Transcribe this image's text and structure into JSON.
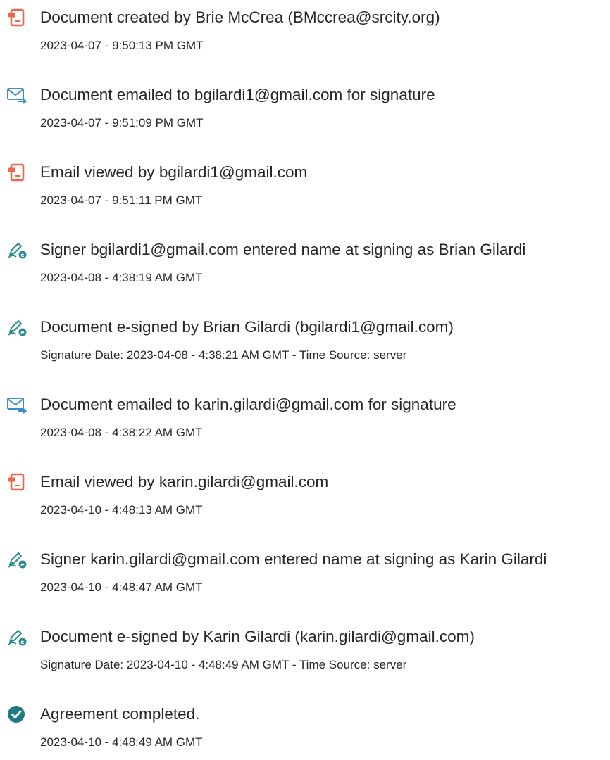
{
  "colors": {
    "doc_icon": "#e8684e",
    "email_icon": "#3d8fc9",
    "sign_icon": "#2b8a8f",
    "complete_icon": "#1f7a86",
    "text": "#262626"
  },
  "events": [
    {
      "icon": "document-icon",
      "title": "Document created by Brie McCrea (BMccrea@srcity.org)",
      "time": "2023-04-07 - 9:50:13 PM GMT"
    },
    {
      "icon": "email-send-icon",
      "title": "Document emailed to bgilardi1@gmail.com for signature",
      "time": "2023-04-07 - 9:51:09 PM GMT"
    },
    {
      "icon": "document-icon",
      "title": "Email viewed by bgilardi1@gmail.com",
      "time": "2023-04-07 - 9:51:11 PM GMT"
    },
    {
      "icon": "esign-pen-icon",
      "title": "Signer bgilardi1@gmail.com entered name at signing as Brian Gilardi",
      "time": "2023-04-08 - 4:38:19 AM GMT"
    },
    {
      "icon": "esign-pen-icon",
      "title": "Document e-signed by Brian Gilardi (bgilardi1@gmail.com)",
      "time": "Signature Date: 2023-04-08 - 4:38:21 AM GMT - Time Source: server"
    },
    {
      "icon": "email-send-icon",
      "title": "Document emailed to karin.gilardi@gmail.com for signature",
      "time": "2023-04-08 - 4:38:22 AM GMT"
    },
    {
      "icon": "document-icon",
      "title": "Email viewed by karin.gilardi@gmail.com",
      "time": "2023-04-10 - 4:48:13 AM GMT"
    },
    {
      "icon": "esign-pen-icon",
      "title": "Signer karin.gilardi@gmail.com entered name at signing as Karin Gilardi",
      "time": "2023-04-10 - 4:48:47 AM GMT"
    },
    {
      "icon": "esign-pen-icon",
      "title": "Document e-signed by Karin Gilardi (karin.gilardi@gmail.com)",
      "time": "Signature Date: 2023-04-10 - 4:48:49 AM GMT - Time Source: server"
    },
    {
      "icon": "check-circle-icon",
      "title": "Agreement completed.",
      "time": "2023-04-10 - 4:48:49 AM GMT"
    }
  ]
}
